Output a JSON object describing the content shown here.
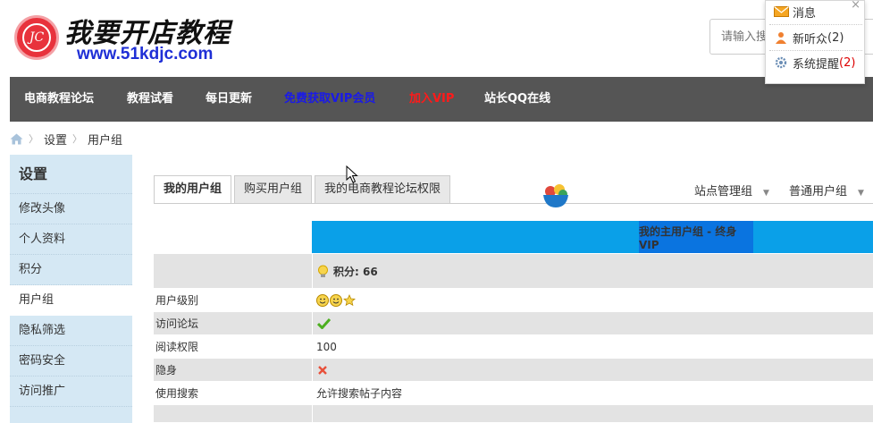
{
  "brand": {
    "logo_initials": "JC",
    "title": "我要开店教程",
    "url": "www.51kdjc.com"
  },
  "search": {
    "placeholder": "请输入搜"
  },
  "notifications": {
    "close": "×",
    "items": [
      {
        "label": "消息",
        "count": ""
      },
      {
        "label": "新听众",
        "count": "(2)"
      },
      {
        "label": "系统提醒",
        "count": "(2)"
      }
    ]
  },
  "nav": {
    "items": [
      {
        "label": "电商教程论坛",
        "color": "#ffffff"
      },
      {
        "label": "教程试看",
        "color": "#ffffff"
      },
      {
        "label": "每日更新",
        "color": "#ffffff"
      },
      {
        "label": "免费获取VIP会员",
        "color": "#1a1ae8"
      },
      {
        "label": "加入VIP",
        "color": "#ff1a1a"
      },
      {
        "label": "站长QQ在线",
        "color": "#ffffff"
      }
    ]
  },
  "breadcrumb": {
    "items": [
      "设置",
      "用户组"
    ]
  },
  "sidebar": {
    "title": "设置",
    "items": [
      "修改头像",
      "个人资料",
      "积分",
      "用户组",
      "隐私筛选",
      "密码安全",
      "访问推广"
    ],
    "active_index": 3
  },
  "tabs": {
    "items": [
      "我的用户组",
      "购买用户组",
      "我的电商教程论坛权限"
    ],
    "active_index": 0
  },
  "group_selectors": [
    "站点管理组",
    "普通用户组"
  ],
  "table": {
    "header": "我的主用户组 - 终身VIP",
    "points_label": "积分: 66",
    "rows": [
      {
        "label": "用户级别",
        "value": "",
        "kind": "level"
      },
      {
        "label": "访问论坛",
        "value": "",
        "kind": "check"
      },
      {
        "label": "阅读权限",
        "value": "100",
        "kind": "text"
      },
      {
        "label": "隐身",
        "value": "",
        "kind": "cross"
      },
      {
        "label": "使用搜索",
        "value": "允许搜索帖子内容",
        "kind": "text"
      }
    ]
  },
  "colors": {
    "nav_bg": "#555555",
    "sidebar_bg": "#d5e8f4",
    "table_head": "#0aa0e8",
    "brand_red": "#e8323c"
  }
}
